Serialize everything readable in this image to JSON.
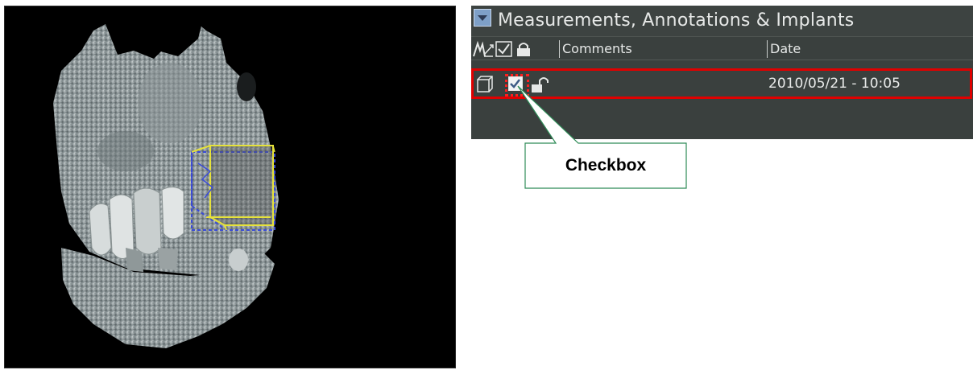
{
  "viewport": {
    "image": "3d-jaw-rendering",
    "bounding_box_colors": {
      "front": "#e6e23a",
      "back": "#3a4bd8"
    }
  },
  "panel": {
    "title": "Measurements, Annotations & Implants",
    "collapse_icon": "collapse-arrow-icon",
    "columns": {
      "type_icon": "measurement-type-icon",
      "visibility_icon": "checkbox-column-icon",
      "lock_icon": "lock-column-icon",
      "comments": "Comments",
      "date": "Date"
    },
    "rows": [
      {
        "type_icon": "implant-box-icon",
        "checked": true,
        "locked": false,
        "comments": "",
        "date": "2010/05/21 - 10:05"
      }
    ],
    "colors": {
      "background": "#3a403e",
      "text": "#e6e8e7",
      "highlight": "#e00000"
    }
  },
  "callout": {
    "label": "Checkbox"
  }
}
